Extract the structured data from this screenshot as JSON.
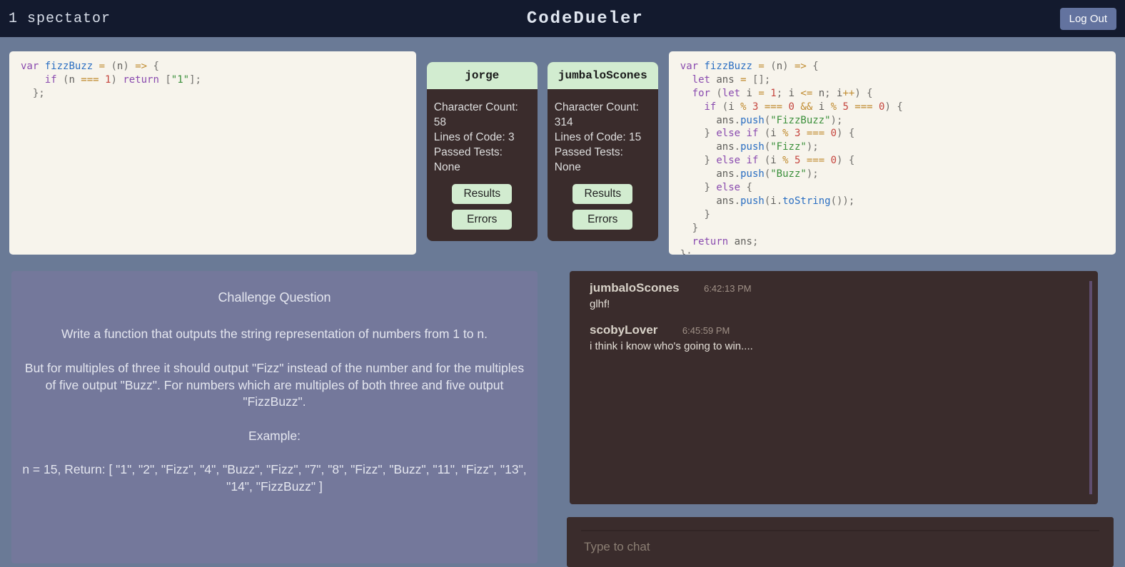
{
  "header": {
    "spectator": "1 spectator",
    "title": "CodeDueler",
    "logout": "Log Out"
  },
  "players": [
    {
      "name": "jorge",
      "char_count_label": "Character Count:",
      "char_count": "58",
      "loc_label": "Lines of Code: 3",
      "passed_label": "Passed Tests:",
      "passed": "None",
      "results_btn": "Results",
      "errors_btn": "Errors"
    },
    {
      "name": "jumbaloScones",
      "char_count_label": "Character Count:",
      "char_count": "314",
      "loc_label": "Lines of Code: 15",
      "passed_label": "Passed Tests:",
      "passed": "None",
      "results_btn": "Results",
      "errors_btn": "Errors"
    }
  ],
  "challenge": {
    "title": "Challenge Question",
    "p1": "Write a function that outputs the string representation of numbers from 1 to n.",
    "p2": "But for multiples of three it should output \"Fizz\" instead of the number and for the multiples of five output \"Buzz\". For numbers which are multiples of both three and five output \"FizzBuzz\".",
    "p3": "Example:",
    "p4": "n = 15, Return: [ \"1\", \"2\", \"Fizz\", \"4\", \"Buzz\", \"Fizz\", \"7\", \"8\", \"Fizz\", \"Buzz\", \"11\", \"Fizz\", \"13\", \"14\", \"FizzBuzz\" ]"
  },
  "chat": {
    "placeholder": "Type to chat",
    "messages": [
      {
        "user": "jumbaloScones",
        "time": "6:42:13 PM",
        "text": "glhf!"
      },
      {
        "user": "scobyLover",
        "time": "6:45:59 PM",
        "text": "i think i know who's going to win...."
      }
    ]
  },
  "code_left": {
    "tok": {
      "var": "var",
      "fizzBuzz": "fizzBuzz",
      "eq": " = ",
      "lp": "(",
      "n": "n",
      "rp": ")",
      "arrow": " => ",
      "lb": "{",
      "if": "if",
      "cond_open": " (",
      "eqeqeq": " === ",
      "one": "1",
      "cond_close": ") ",
      "return": "return",
      "sp": " ",
      "sqo": "[",
      "str1": "\"1\"",
      "sqc": "]",
      "semi": ";",
      "rb": "}"
    }
  },
  "code_right": {
    "tok": {
      "var": "var",
      "fizzBuzz": "fizzBuzz",
      "eq": " = ",
      "lp": "(",
      "n": "n",
      "rp": ")",
      "arrow": " => ",
      "lb": "{",
      "let": "let",
      "ans": "ans",
      "eq2": " = ",
      "arr": "[]",
      "semi": ";",
      "for": "for",
      "fo": " (",
      "leti": "let",
      "i": "i",
      "eq1": " = ",
      "one": "1",
      "sc": "; ",
      "lte": " <= ",
      "ipp": "++",
      "fc": ") ",
      "if": "if",
      "co": " (",
      "mod": " % ",
      "three": "3",
      "eqeqeq": " === ",
      "zero": "0",
      "andand": " && ",
      "five": "5",
      "cc": ") ",
      "push": "push",
      "dot": ".",
      "fizzbuzz_str": "\"FizzBuzz\"",
      "fizz_str": "\"Fizz\"",
      "buzz_str": "\"Buzz\"",
      "rb": "}",
      "else": "else",
      "elseif": "else if",
      "toString": "toString",
      "empty_call": "()",
      "return": "return",
      "sp": " "
    }
  }
}
